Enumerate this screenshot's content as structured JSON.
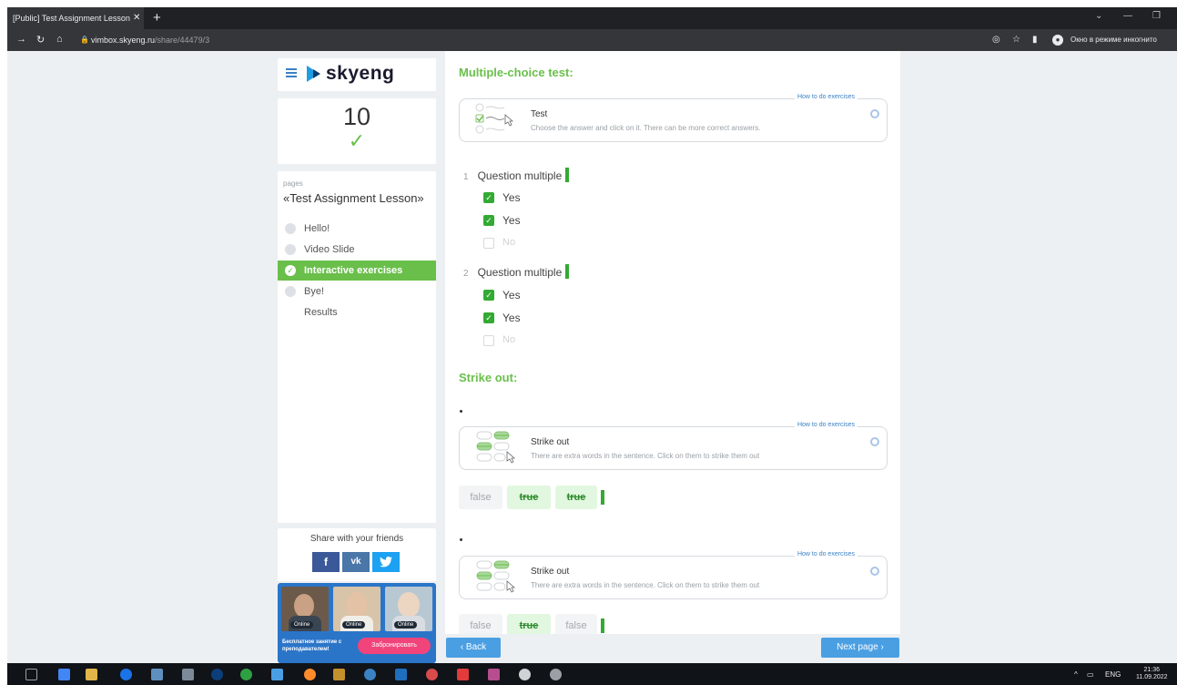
{
  "browser": {
    "tab_title": "[Public] Test Assignment Lesson",
    "tab_close": "✕",
    "new_tab": "+",
    "url_host": "vimbox.skyeng.ru",
    "url_path": "/share/44479/3",
    "incognito": "Окно в режиме инкогнито"
  },
  "sidebar": {
    "logo": "skyeng",
    "score": "10",
    "score_check": "✓",
    "pages_label": "pages",
    "lesson_title": "«Test Assignment Lesson»",
    "items": [
      {
        "label": "Hello!",
        "active": false
      },
      {
        "label": "Video Slide",
        "active": false
      },
      {
        "label": "Interactive exercises",
        "active": true
      },
      {
        "label": "Bye!",
        "active": false
      },
      {
        "label": "Results",
        "active": false
      }
    ],
    "share_title": "Share with your friends",
    "socials": [
      "f",
      "vk",
      "tw"
    ],
    "colors": {
      "facebook": "#3b5998",
      "vk": "#4a76a8",
      "twitter": "#1da1f2"
    },
    "promo": {
      "online": "Online",
      "text": "Бесплатное занятие с преподавателем!",
      "button": "Забронировать"
    }
  },
  "main": {
    "section1_title": "Multiple-choice test:",
    "test_block": {
      "how": "How to do exercises",
      "title": "Test",
      "desc": "Choose the answer and click on it. There can be more correct answers."
    },
    "questions": [
      {
        "num": "1",
        "text": "Question multiple",
        "options": [
          {
            "label": "Yes",
            "checked": true
          },
          {
            "label": "Yes",
            "checked": true
          },
          {
            "label": "No",
            "checked": false
          }
        ]
      },
      {
        "num": "2",
        "text": "Question multiple",
        "options": [
          {
            "label": "Yes",
            "checked": true
          },
          {
            "label": "Yes",
            "checked": true
          },
          {
            "label": "No",
            "checked": false
          }
        ]
      }
    ],
    "section2_title": "Strike out:",
    "strike_blocks": [
      {
        "how": "How to do exercises",
        "title": "Strike out",
        "desc": "There are extra words in the sentence. Click on them to strike them out",
        "chips": [
          "false",
          "true",
          "true"
        ]
      },
      {
        "how": "How to do exercises",
        "title": "Strike out",
        "desc": "There are extra words in the sentence. Click on them to strike them out",
        "chips": [
          "false",
          "true",
          "false"
        ]
      }
    ],
    "back": "‹ Back",
    "next": "Next page ›"
  },
  "taskbar": {
    "lang": "ENG",
    "time": "21:36",
    "date": "11.09.2022"
  },
  "colors": {
    "accent_green": "#6abf4b",
    "blue": "#4a9fe3",
    "marker_green": "#33aa33"
  }
}
